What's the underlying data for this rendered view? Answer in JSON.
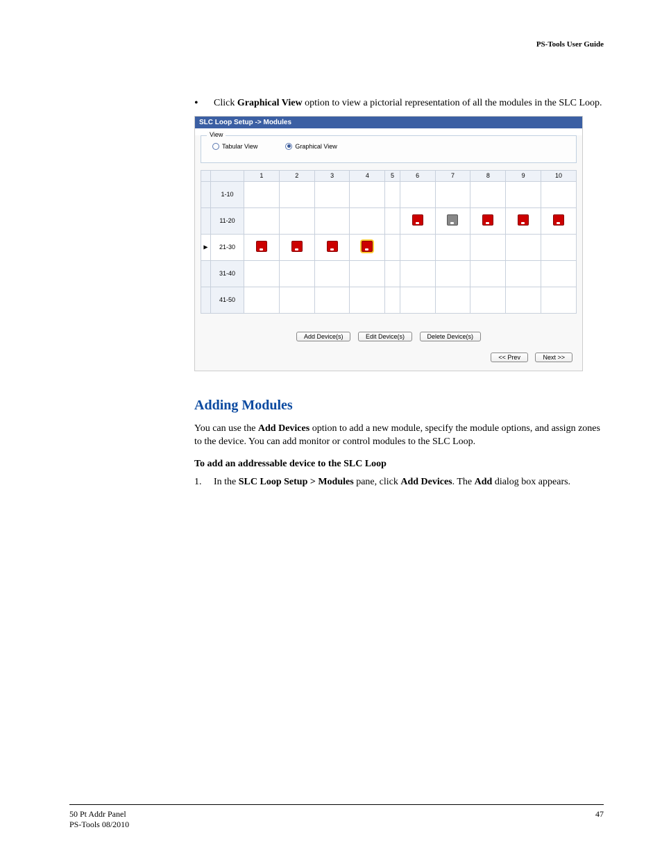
{
  "header": {
    "right": "PS-Tools User Guide"
  },
  "bullet": {
    "prefix": "•",
    "pre": "Click ",
    "bold": "Graphical View",
    "post": " option to view a pictorial representation of all the modules in the SLC Loop."
  },
  "screenshot": {
    "title": "SLC Loop Setup -> Modules",
    "view_legend": "View",
    "radio_tabular": "Tabular View",
    "radio_graphical": "Graphical View",
    "cols": [
      "1",
      "2",
      "3",
      "4",
      "5",
      "6",
      "7",
      "8",
      "9",
      "10"
    ],
    "rows": [
      "1-10",
      "11-20",
      "21-30",
      "31-40",
      "41-50"
    ],
    "buttons": {
      "add": "Add Device(s)",
      "edit": "Edit Device(s)",
      "delete": "Delete Device(s)",
      "prev": "<< Prev",
      "next": "Next >>"
    }
  },
  "section_heading": "Adding Modules",
  "para": {
    "pre": "You can use the ",
    "b": "Add Devices",
    "post": " option to add a new module, specify the module options, and assign zones to the device. You can add monitor or control modules to the SLC Loop."
  },
  "subhead": "To add an addressable device to the SLC Loop",
  "step1": {
    "n": "1.",
    "pre": "In the ",
    "b1": "SLC Loop Setup > Modules",
    "mid": " pane, click ",
    "b2": "Add Devices",
    "mid2": ". The ",
    "b3": "Add",
    "post": " dialog box appears."
  },
  "footer": {
    "line1": "50 Pt Addr Panel",
    "line2": "PS-Tools  08/2010",
    "page": "47"
  }
}
